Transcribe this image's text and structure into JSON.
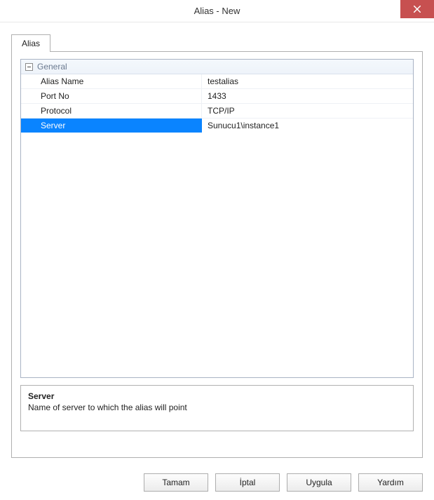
{
  "window": {
    "title": "Alias - New"
  },
  "tabs": {
    "alias": "Alias"
  },
  "propertyGrid": {
    "groupName": "General",
    "rows": [
      {
        "name": "Alias Name",
        "value": "testalias",
        "selected": false
      },
      {
        "name": "Port No",
        "value": "1433",
        "selected": false
      },
      {
        "name": "Protocol",
        "value": "TCP/IP",
        "selected": false
      },
      {
        "name": "Server",
        "value": "Sunucu1\\instance1",
        "selected": true
      }
    ],
    "help": {
      "title": "Server",
      "desc": "Name of server to which the alias will point"
    }
  },
  "buttons": {
    "ok": "Tamam",
    "cancel": "İptal",
    "apply": "Uygula",
    "help": "Yardım"
  }
}
